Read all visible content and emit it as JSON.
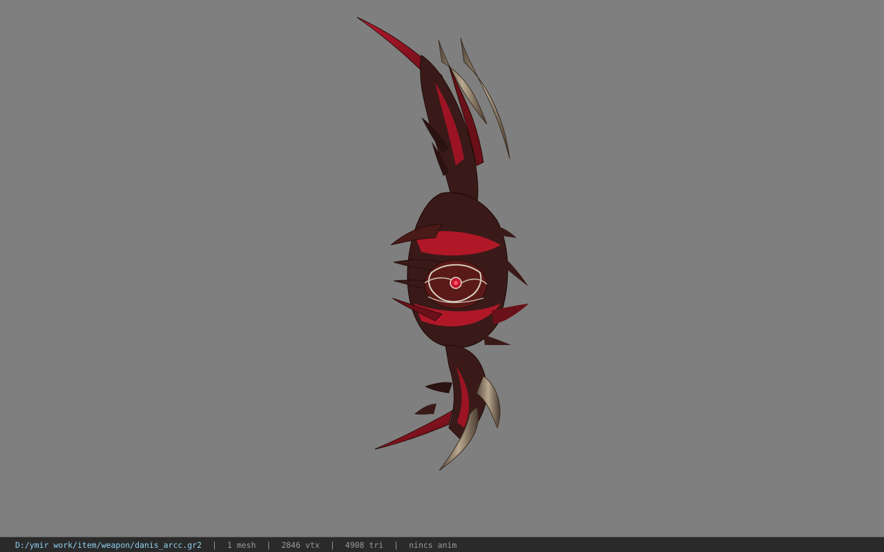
{
  "viewport": {
    "background_color": "#7f7f7f",
    "model_name": "bow-model",
    "model_colors": {
      "body": "#3a1a18",
      "accent": "#b01828",
      "bone": "#8a7a68",
      "highlight": "#d8d0c0"
    }
  },
  "statusbar": {
    "file_path": "D:/ymir work/item/weapon/danis_arcc.gr2",
    "separator": "|",
    "mesh_count": "1 mesh",
    "vertex_count": "2846 vtx",
    "triangle_count": "4908 tri",
    "anim_status": "nincs anim",
    "path_color": "#8fd0f0",
    "text_color": "#9a9a9a"
  }
}
